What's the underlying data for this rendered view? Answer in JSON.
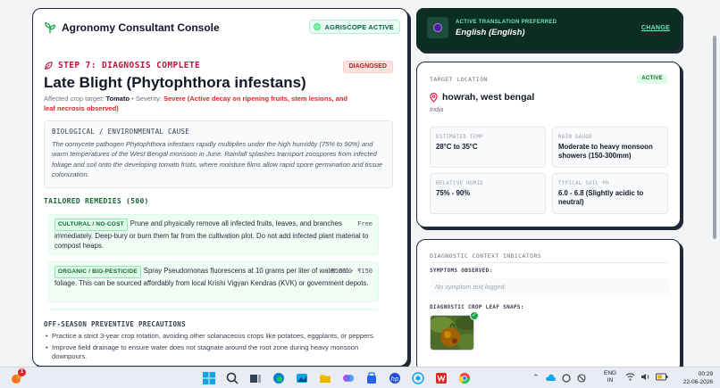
{
  "header": {
    "app_title": "Agronomy Consultant Console",
    "status_chip": "AGRISCOPE ACTIVE"
  },
  "diagnosis": {
    "step_label": "STEP 7: DIAGNOSIS COMPLETE",
    "badge": "DIAGNOSED",
    "title": "Late Blight (Phytophthora infestans)",
    "crop_prefix": "Affected crop target:",
    "crop": "Tomato",
    "severity_prefix": "• Severity:",
    "severity": "Severe (Active decay on ripening fruits, stem lesions, and leaf necrosis observed)"
  },
  "cause": {
    "title": "BIOLOGICAL / ENVIRONMENTAL CAUSE",
    "text": "The oomycete pathogen Phytophthora infestans rapidly multiplies under the high humidity (75% to 90%) and warm temperatures of the West Bengal monsoon in June. Rainfall splashes transport zoospores from infected foliage and soil onto the developing tomato fruits, where moisture films allow rapid spore germination and tissue colonization."
  },
  "remedies": {
    "title": "TAILORED REMEDIES (500)",
    "items": [
      {
        "tag": "CULTURAL / NO-COST",
        "text": "Prune and physically remove all infected fruits, leaves, and branches immediately. Deep-bury or burn them far from the cultivation plot. Do not add infected plant material to compost heaps.",
        "cost": "Free"
      },
      {
        "tag": "ORGANIC / BIO-PESTICIDE",
        "text": "Spray Pseudomonas fluorescens at 10 grams per liter of water onto foliage. This can be sourced affordably from local Krishi Vigyan Kendras (KVK) or government depots.",
        "cost": "₹100 - ₹150"
      }
    ]
  },
  "offseason": {
    "title": "OFF-SEASON PREVENTIVE PRECAUTIONS",
    "items": [
      "Practice a strict 3-year crop rotation, avoiding other solanaceous crops like potatoes, eggplants, or peppers.",
      "Improve field drainage to ensure water does not stagnate around the root zone during heavy monsoon downpours."
    ]
  },
  "translation": {
    "caption": "ACTIVE TRANSLATION PREFERRED",
    "language": "English (English)",
    "change_label": "CHANGE"
  },
  "location": {
    "heading": "TARGET LOCATION",
    "status": "ACTIVE",
    "name": "howrah, west bengal",
    "country": "India",
    "metrics": [
      {
        "label": "ESTIMATED TEMP",
        "value": "28°C to 35°C"
      },
      {
        "label": "RAIN GAUGE",
        "value": "Moderate to heavy monsoon showers (150-300mm)"
      },
      {
        "label": "RELATIVE HUMID",
        "value": "75% - 90%"
      },
      {
        "label": "TYPICAL SOIL PH",
        "value": "6.0 - 6.8 (Slightly acidic to neutral)"
      }
    ]
  },
  "context": {
    "heading": "DIAGNOSTIC CONTEXT INDICATORS",
    "symptoms_label": "SYMPTOMS OBSERVED:",
    "symptoms_placeholder": "No symptom text logged.",
    "snaps_label": "DIAGNOSTIC CROP LEAF SNAPS:"
  },
  "taskbar": {
    "notification_count": "1",
    "lang_line1": "ENG",
    "lang_line2": "IN",
    "time": "00:29",
    "date": "22-06-2026"
  },
  "colors": {
    "accent_green": "#166534",
    "alert_red": "#be123c",
    "dark_banner": "#0b2d22"
  }
}
